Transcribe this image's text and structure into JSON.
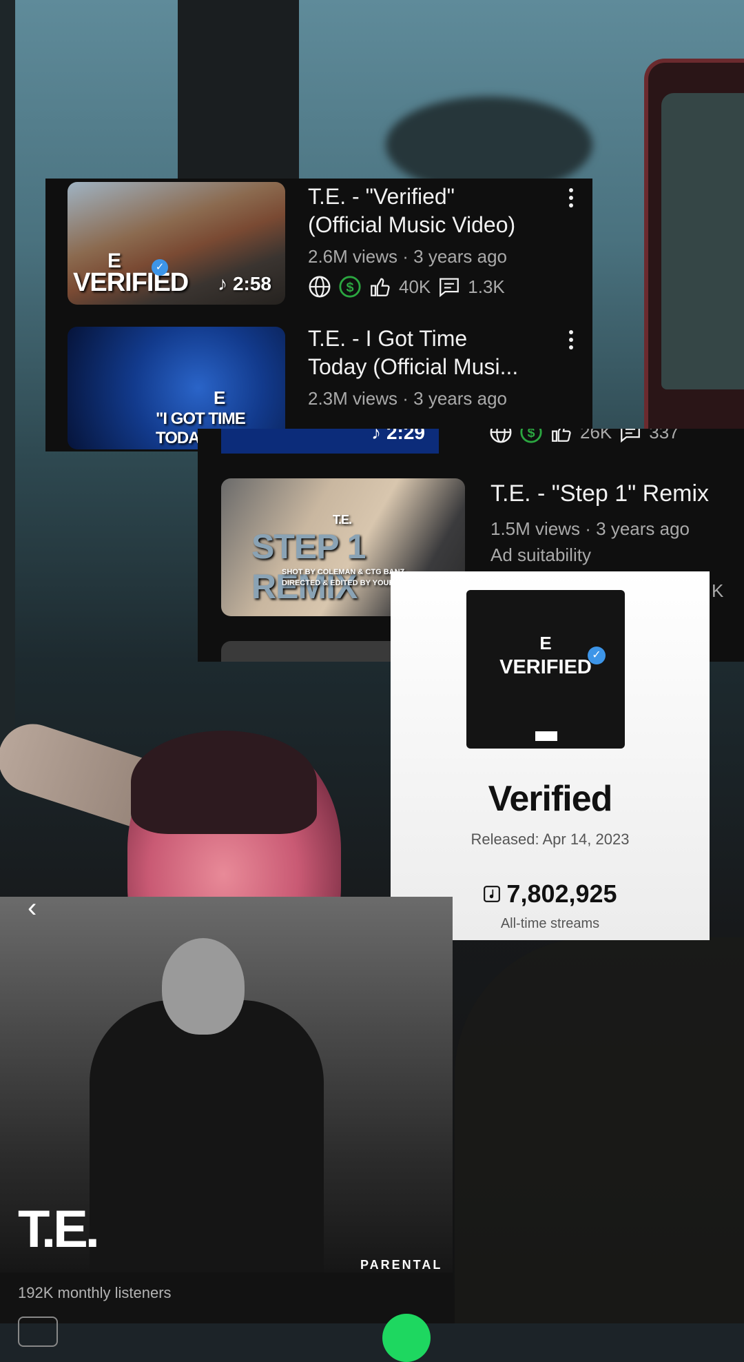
{
  "videos": [
    {
      "title_line1": "T.E. - \"Verified\"",
      "title_line2": "(Official Music Video)",
      "meta": "2.6M views · 3 years ago",
      "likes": "40K",
      "comments": "1.3K",
      "duration": "2:58",
      "thumb_text": "VERIFIED",
      "thumb_logo": "E"
    },
    {
      "title_line1": "T.E. - I Got Time",
      "title_line2": "Today (Official Musi...",
      "meta": "2.3M views · 3 years ago",
      "thumb_text": "\"I GOT TIME TODAY\"",
      "thumb_logo": "E",
      "duration": "2:29",
      "likes": "26K",
      "comments": "337"
    },
    {
      "title": "T.E. - \"Step 1\" Remix",
      "meta": "1.5M views · 3 years ago",
      "extra": "Ad suitability",
      "thumb_text": "STEP 1 REMIX",
      "thumb_logo": "T.E.",
      "thumb_credit1": "SHOT BY COLEMAN & CTG BANZ",
      "thumb_credit2": "DIRECTED & EDITED BY YOURS TRULY",
      "likes_partial": "K"
    }
  ],
  "release": {
    "cover_logo": "E",
    "cover_title": "VERIFIED",
    "title": "Verified",
    "released": "Released: Apr 14, 2023",
    "streams": "7,802,925",
    "streams_label": "All-time streams"
  },
  "artist": {
    "name": "T.E.",
    "listeners": "192K monthly listeners",
    "parental": "PARENTAL"
  },
  "colors": {
    "yt_bg": "#0f0f0f",
    "monetized_green": "#2ba640",
    "verified_blue": "#3d95e8",
    "spotify_green": "#1ed760"
  }
}
